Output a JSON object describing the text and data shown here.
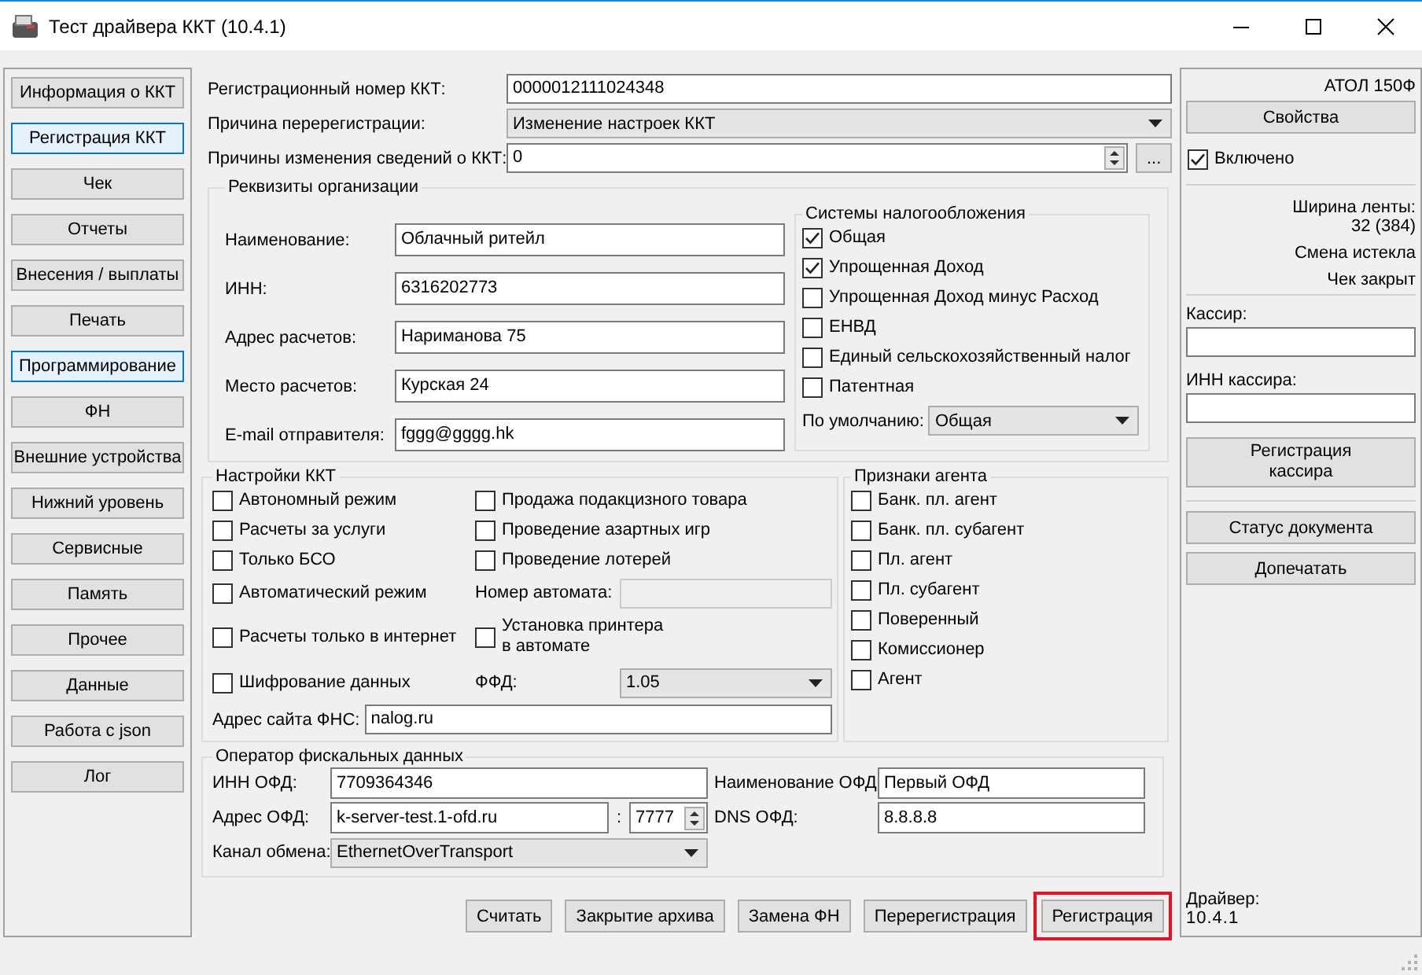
{
  "window": {
    "title": "Тест драйвера ККТ (10.4.1)"
  },
  "nav": [
    {
      "label": "Информация о ККТ",
      "selected": false
    },
    {
      "label": "Регистрация ККТ",
      "selected": true
    },
    {
      "label": "Чек",
      "selected": false
    },
    {
      "label": "Отчеты",
      "selected": false
    },
    {
      "label": "Внесения / выплаты",
      "selected": false
    },
    {
      "label": "Печать",
      "selected": false
    },
    {
      "label": "Программирование",
      "selected": true
    },
    {
      "label": "ФН",
      "selected": false
    },
    {
      "label": "Внешние устройства",
      "selected": false
    },
    {
      "label": "Нижний уровень",
      "selected": false
    },
    {
      "label": "Сервисные",
      "selected": false
    },
    {
      "label": "Память",
      "selected": false
    },
    {
      "label": "Прочее",
      "selected": false
    },
    {
      "label": "Данные",
      "selected": false
    },
    {
      "label": "Работа с json",
      "selected": false
    },
    {
      "label": "Лог",
      "selected": false
    }
  ],
  "registration": [
    {
      "kind": "field",
      "label": "Регистрационный номер ККТ:",
      "value": "0000012111024348"
    },
    {
      "kind": "combo",
      "label": "Причина перерегистрации:",
      "value": "Изменение настроек ККТ"
    },
    {
      "kind": "spin",
      "label": "Причины изменения сведений о ККТ:",
      "value": "0",
      "button": "..."
    }
  ],
  "organization": {
    "title": "Реквизиты организации",
    "fields": [
      {
        "label": "Наименование:",
        "value": "Облачный ритейл"
      },
      {
        "label": "ИНН:",
        "value": "6316202773"
      },
      {
        "label": "Адрес расчетов:",
        "value": "Нариманова 75"
      },
      {
        "label": "Место расчетов:",
        "value": "Курская 24"
      },
      {
        "label": "E-mail отправителя:",
        "value": "fggg@gggg.hk"
      }
    ],
    "tax": {
      "title": "Системы налогообложения",
      "options": [
        {
          "label": "Общая",
          "checked": true
        },
        {
          "label": "Упрощенная Доход",
          "checked": true
        },
        {
          "label": "Упрощенная Доход минус Расход",
          "checked": false
        },
        {
          "label": "ЕНВД",
          "checked": false
        },
        {
          "label": "Единый сельскохозяйственный налог",
          "checked": false
        },
        {
          "label": "Патентная",
          "checked": false
        }
      ],
      "default": {
        "label": "По умолчанию:",
        "value": "Общая"
      }
    }
  },
  "settings": {
    "title": "Настройки ККТ",
    "items": [
      {
        "kind": "checkbox",
        "label": "Автономный режим",
        "checked": false
      },
      {
        "kind": "checkbox",
        "label": "Продажа подакцизного товара",
        "checked": false
      },
      {
        "kind": "checkbox",
        "label": "Расчеты за услуги",
        "checked": false
      },
      {
        "kind": "checkbox",
        "label": "Проведение азартных игр",
        "checked": false
      },
      {
        "kind": "checkbox",
        "label": "Только БСО",
        "checked": false
      },
      {
        "kind": "checkbox",
        "label": "Проведение лотерей",
        "checked": false
      },
      {
        "kind": "checkbox",
        "label": "Автоматический режим",
        "checked": false
      },
      {
        "kind": "field",
        "label": "Номер автомата:",
        "disabled": true
      },
      {
        "kind": "checkbox",
        "label": "Расчеты только в интернет",
        "checked": false
      },
      {
        "kind": "checkbox",
        "label": "Установка принтера\nв автомате",
        "checked": false
      },
      {
        "kind": "checkbox",
        "label": "Шифрование данных",
        "checked": false
      },
      {
        "kind": "combo",
        "label": "ФФД:",
        "value": "1.05"
      }
    ],
    "fns_site": {
      "label": "Адрес сайта ФНС:",
      "value": "nalog.ru"
    }
  },
  "agent": {
    "title": "Признаки агента",
    "options": [
      {
        "label": "Банк. пл. агент",
        "checked": false
      },
      {
        "label": "Банк. пл. субагент",
        "checked": false
      },
      {
        "label": "Пл. агент",
        "checked": false
      },
      {
        "label": "Пл. субагент",
        "checked": false
      },
      {
        "label": "Поверенный",
        "checked": false
      },
      {
        "label": "Комиссионер",
        "checked": false
      },
      {
        "label": "Агент",
        "checked": false
      }
    ]
  },
  "ofd": {
    "title": "Оператор фискальных данных",
    "inn": {
      "label": "ИНН ОФД:",
      "value": "7709364346"
    },
    "name": {
      "label": "Наименование ОФД:",
      "value": "Первый ОФД"
    },
    "address": {
      "label": "Адрес ОФД:",
      "value": "k-server-test.1-ofd.ru",
      "separator": ":",
      "port": "7777"
    },
    "dns": {
      "label": "DNS ОФД:",
      "value": "8.8.8.8"
    },
    "channel": {
      "label": "Канал обмена:",
      "value": "EthernetOverTransport"
    }
  },
  "actions": [
    {
      "label": "Считать",
      "highlighted": false
    },
    {
      "label": "Закрытие архива",
      "highlighted": false
    },
    {
      "label": "Замена ФН",
      "highlighted": false
    },
    {
      "label": "Перерегистрация",
      "highlighted": false
    },
    {
      "label": "Регистрация",
      "highlighted": true
    }
  ],
  "device": {
    "model": "АТОЛ 150Ф",
    "properties_button": "Свойства",
    "enabled": {
      "label": "Включено",
      "checked": true
    },
    "paper_width": {
      "label": "Ширина ленты:",
      "value": "32 (384)"
    },
    "shift": "Смена истекла",
    "receipt": "Чек закрыт",
    "cashier": {
      "label": "Кассир:"
    },
    "cashier_inn": {
      "label": "ИНН кассира:"
    },
    "cashier_button": "Регистрация\nкассира",
    "buttons": [
      "Статус документа",
      "Допечатать"
    ],
    "driver": {
      "label": "Драйвер:",
      "version": "10.4.1"
    }
  }
}
